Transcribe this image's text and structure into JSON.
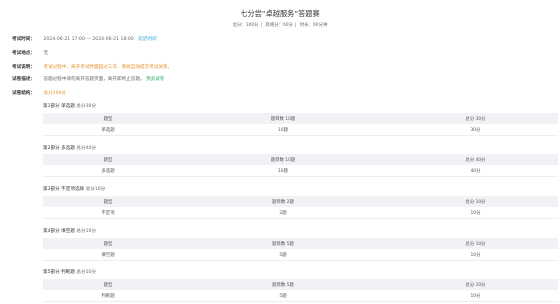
{
  "exam": {
    "title": "七分尝“卓越服务”答题赛",
    "total_score": "总分：100分",
    "pass_score": "及格分：60分",
    "duration": "时长：60分钟"
  },
  "info": {
    "time": {
      "label": "考试时间：",
      "value": "2024-06-21 17:00 — 2024-06-21 18:00",
      "tag": "延迟时间"
    },
    "place": {
      "label": "考试地点：",
      "value": "无"
    },
    "notes": {
      "label": "考试说明：",
      "value": "考试过程中，离开考试界面超过三次，系统自动提交考试试卷。"
    },
    "desc": {
      "label": "试卷描述：",
      "value": "答题过程中请勿离开答题页面，离开即终止答题。",
      "tag": "预览试卷"
    },
    "structure": {
      "label": "试卷结构：",
      "value": "总分100分"
    }
  },
  "table_headers": {
    "type": "题型",
    "count": "题目数",
    "score": "总分"
  },
  "sections": [
    {
      "title": "第1部分 单选题",
      "points": "总分30分",
      "head_type": "题型",
      "head_count": "题目数 10题",
      "head_score": "总分 30分",
      "row_type": "单选题",
      "row_count": "10题",
      "row_score": "30分"
    },
    {
      "title": "第2部分 多选题",
      "points": "总分40分",
      "head_type": "题型",
      "head_count": "题目数 10题",
      "head_score": "总分 40分",
      "row_type": "多选题",
      "row_count": "10题",
      "row_score": "40分"
    },
    {
      "title": "第3部分 不定项选择",
      "points": "总分10分",
      "head_type": "题型",
      "head_count": "题目数 2题",
      "head_score": "总分 10分",
      "row_type": "不定项",
      "row_count": "2题",
      "row_score": "10分"
    },
    {
      "title": "第4部分 填空题",
      "points": "总分10分",
      "head_type": "题型",
      "head_count": "题目数 5题",
      "head_score": "总分 10分",
      "row_type": "填空题",
      "row_count": "5题",
      "row_score": "10分"
    },
    {
      "title": "第5部分 判断题",
      "points": "总分10分",
      "head_type": "题型",
      "head_count": "题目数 5题",
      "head_score": "总分 10分",
      "row_type": "判断题",
      "row_count": "5题",
      "row_score": "10分"
    }
  ]
}
